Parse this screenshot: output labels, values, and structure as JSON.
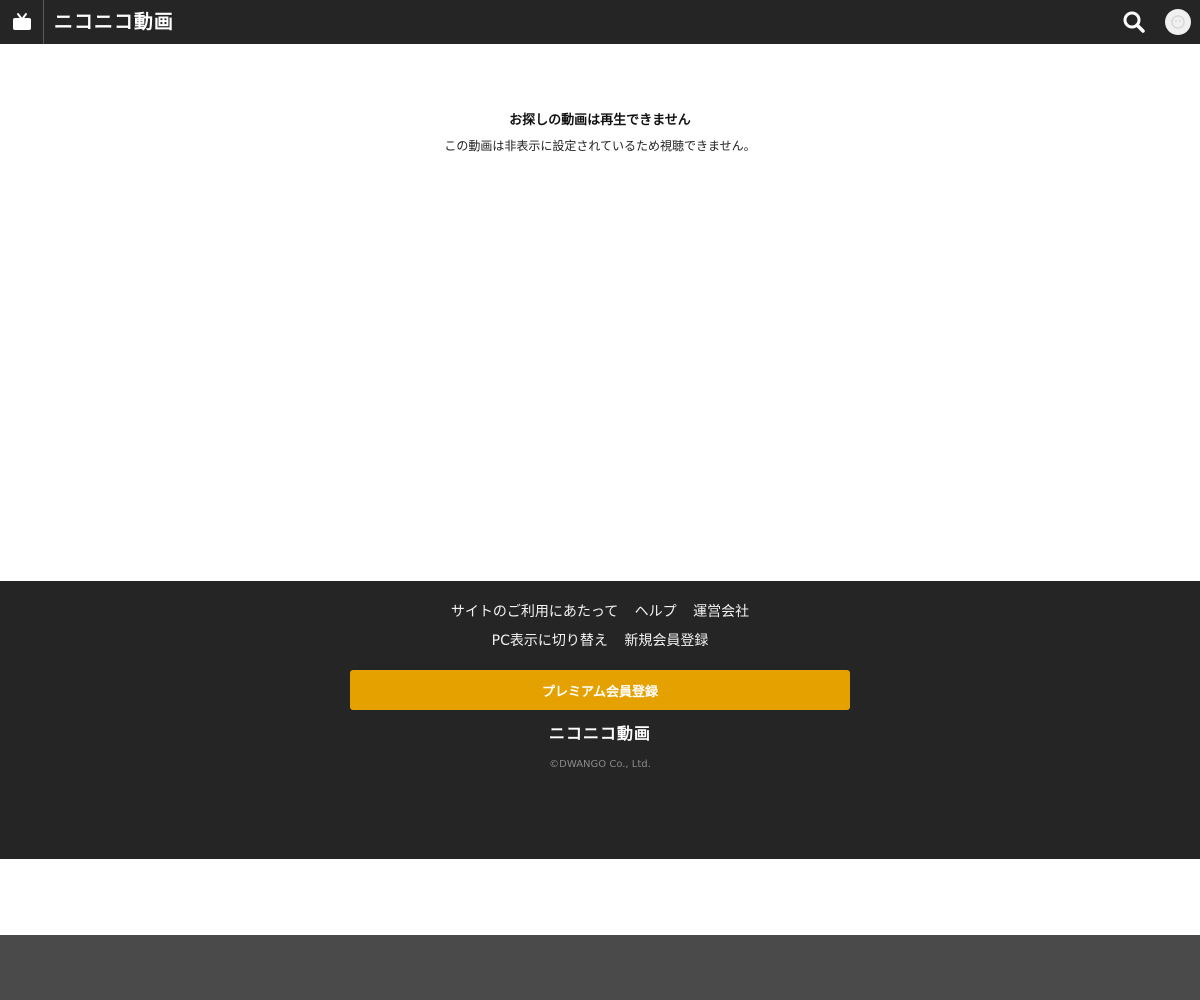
{
  "header": {
    "brand_text": "ニコニコ動画",
    "tv_icon": "tv-icon",
    "search_icon": "search-icon",
    "avatar_icon": "user-avatar-icon"
  },
  "message": {
    "title": "お探しの動画は再生できません",
    "body": "この動画は非表示に設定されているため視聴できません。"
  },
  "footer": {
    "links_row1": [
      "サイトのご利用にあたって",
      "ヘルプ",
      "運営会社"
    ],
    "links_row2": [
      "PC表示に切り替え",
      "新規会員登録"
    ],
    "premium_button": "プレミアム会員登録",
    "logo_text": "ニコニコ動画",
    "copyright": "©DWANGO Co., Ltd."
  },
  "colors": {
    "header_bg": "#252525",
    "footer_bg": "#252525",
    "premium_button": "#e5a100",
    "bottom_bar": "#4a4a4a"
  }
}
